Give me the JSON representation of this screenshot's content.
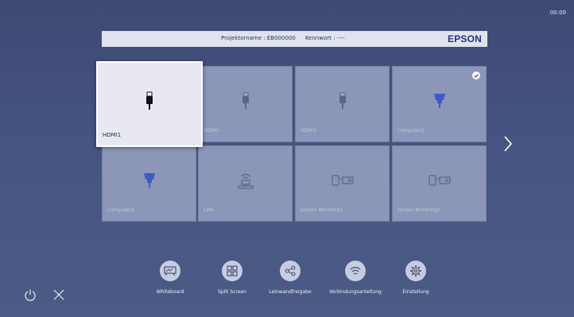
{
  "clock": "00:00",
  "info_bar": {
    "projector_label": "Projektorname : EB000000",
    "password_label": "Kennwort : ----",
    "brand": "EPSON"
  },
  "sources": [
    {
      "label": "HDMI1",
      "icon": "hdmi-icon",
      "selected": true
    },
    {
      "label": "HDMI2",
      "icon": "hdmi-icon",
      "selected": false
    },
    {
      "label": "HDMI3",
      "icon": "hdmi-icon",
      "selected": false
    },
    {
      "label": "Computer1",
      "icon": "vga-icon",
      "selected": false,
      "checked": true
    },
    {
      "label": "Computer2",
      "icon": "vga-icon",
      "selected": false
    },
    {
      "label": "LAN",
      "icon": "lan-icon",
      "selected": false
    },
    {
      "label": "Screen Mirroring1",
      "icon": "screen-mirroring-icon",
      "selected": false
    },
    {
      "label": "Screen Mirroring2",
      "icon": "screen-mirroring-icon",
      "selected": false
    }
  ],
  "toolbar": [
    {
      "label": "Whiteboard",
      "icon": "whiteboard-icon"
    },
    {
      "label": "Split Screen",
      "icon": "split-screen-icon"
    },
    {
      "label": "Leinwandfreigabe",
      "icon": "share-icon"
    },
    {
      "label": "Verbindungsanleitung",
      "icon": "wifi-icon"
    },
    {
      "label": "Einstellung",
      "icon": "settings-gear-icon"
    }
  ],
  "bottom_controls": [
    "power-icon",
    "close-icon"
  ],
  "colors": {
    "background": "#465481",
    "tile": "#8b96b8",
    "selected_tile": "#e7e8f1",
    "brand": "#24337a",
    "vga_blue": "#3d5bc8"
  }
}
